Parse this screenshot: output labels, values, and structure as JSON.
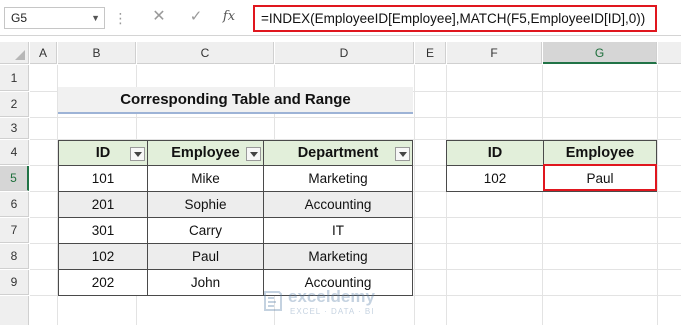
{
  "formula_bar": {
    "name_box": "G5",
    "cancel_icon": "✕",
    "enter_icon": "✓",
    "fx_label": "fx",
    "formula": "=INDEX(EmployeeID[Employee],MATCH(F5,EmployeeID[ID],0))"
  },
  "columns": [
    "A",
    "B",
    "C",
    "D",
    "E",
    "F",
    "G"
  ],
  "rows": [
    "1",
    "2",
    "3",
    "4",
    "5",
    "6",
    "7",
    "8",
    "9"
  ],
  "selected_cell": {
    "column": "G",
    "row": "5"
  },
  "title": "Corresponding Table and Range",
  "main_table": {
    "headers": [
      "ID",
      "Employee",
      "Department"
    ],
    "rows": [
      [
        "101",
        "Mike",
        "Marketing"
      ],
      [
        "201",
        "Sophie",
        "Accounting"
      ],
      [
        "301",
        "Carry",
        "IT"
      ],
      [
        "102",
        "Paul",
        "Marketing"
      ],
      [
        "202",
        "John",
        "Accounting"
      ]
    ]
  },
  "lookup_table": {
    "headers": [
      "ID",
      "Employee"
    ],
    "row": [
      "102",
      "Paul"
    ]
  },
  "watermark": {
    "name": "exceldemy",
    "tagline": "EXCEL · DATA · BI"
  },
  "colors": {
    "header_fill": "#e2efda",
    "accent_red": "#e0161e",
    "excel_green": "#217346"
  }
}
